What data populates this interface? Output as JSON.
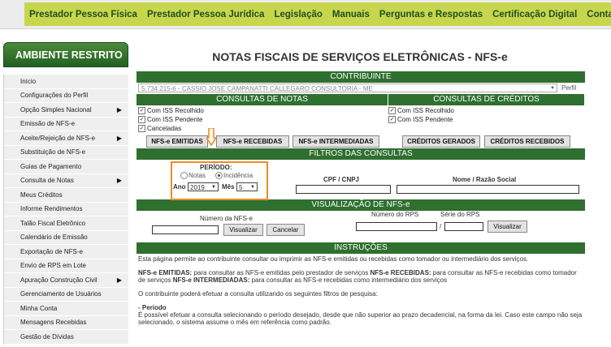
{
  "topnav": {
    "items": [
      "Prestador Pessoa Física",
      "Prestador Pessoa Jurídica",
      "Legislação",
      "Manuais",
      "Perguntas e Respostas",
      "Certificação Digital",
      "Contato"
    ]
  },
  "sidebar": {
    "title": "AMBIENTE RESTRITO",
    "items": [
      {
        "label": "Início",
        "arrow": ""
      },
      {
        "label": "Configurações do Perfil",
        "arrow": ""
      },
      {
        "label": "Opção Simples Nacional",
        "arrow": "▶"
      },
      {
        "label": "Emissão de NFS-e",
        "arrow": ""
      },
      {
        "label": "Aceite/Rejeição de NFS-e",
        "arrow": "▶"
      },
      {
        "label": "Substituição de NFS-e",
        "arrow": ""
      },
      {
        "label": "Guias de Pagamento",
        "arrow": ""
      },
      {
        "label": "Consulta de Notas",
        "arrow": "▶"
      },
      {
        "label": "Meus Créditos",
        "arrow": ""
      },
      {
        "label": "Informe Rendimentos",
        "arrow": ""
      },
      {
        "label": "Talão Fiscal Eletrônico",
        "arrow": ""
      },
      {
        "label": "Calendário de Emissão",
        "arrow": ""
      },
      {
        "label": "Exportação de NFS-e",
        "arrow": ""
      },
      {
        "label": "Envio de RPS em Lote",
        "arrow": ""
      },
      {
        "label": "Apuração Construção Civil",
        "arrow": "▶"
      },
      {
        "label": "Gerenciamento de Usuários",
        "arrow": ""
      },
      {
        "label": "Minha Conta",
        "arrow": ""
      },
      {
        "label": "Mensagens Recebidas",
        "arrow": ""
      },
      {
        "label": "Gestão de Dívidas",
        "arrow": ""
      }
    ]
  },
  "main": {
    "title": "NOTAS FISCAIS DE SERVIÇOS ELETRÔNICAS - NFS-e",
    "contribuinte_header": "CONTRIBUINTE",
    "contribuinte_value": "5.734.215-6 - CASSIO JOSE CAMPANATTI CALLEGARO CONSULTORIA - ME",
    "perfil_label": "Perfil",
    "consultas_notas_header": "CONSULTAS DE NOTAS",
    "consultas_creditos_header": "CONSULTAS DE CRÉDITOS",
    "notas_checks": [
      "Com ISS Recolhido",
      "Com ISS Pendente",
      "Canceladas"
    ],
    "creditos_checks": [
      "Com ISS Recolhido",
      "Com ISS Pendente"
    ],
    "buttons": {
      "emitidas": "NFS-e EMITIDAS",
      "recebidas": "NFS-e RECEBIDAS",
      "intermediadas": "NFS-e INTERMEDIADAS",
      "creditos_gerados": "CRÉDITOS GERADOS",
      "creditos_recebidos": "CRÉDITOS RECEBIDOS"
    },
    "filtros_header": "FILTROS DAS CONSULTAS",
    "periodo_label": "PERÍODO:",
    "radio_notas": "Notas",
    "radio_incidencia": "Incidência",
    "ano_label": "Ano",
    "ano_value": "2019",
    "mes_label": "Mês",
    "mes_value": "5",
    "cpf_label": "CPF / CNPJ",
    "nome_label": "Nome / Razão Social",
    "visualizacao_header": "VISUALIZAÇÃO DE NFS-e",
    "numero_nfse_label": "Número da NFS-e",
    "visualizar_label": "Visualizar",
    "cancelar_label": "Cancelar",
    "numero_rps_label": "Número do RPS",
    "serie_rps_label": "Série do RPS",
    "rps_separator": "/",
    "instrucoes_header": "INSTRUÇÕES",
    "instr_intro": "Esta página permite ao contribuinte consultar ou imprimir as NFS-e emitidas ou recebidas como tomador ou intermediário dos serviços.",
    "instr_emitidas_label": "NFS-e EMITIDAS:",
    "instr_emitidas_text": " para consultar as NFS-e emitidas pelo prestador de serviços ",
    "instr_recebidas_label": "NFS-e RECEBIDAS:",
    "instr_recebidas_text": " para consultar as NFS-e recebidas como tomador de serviços ",
    "instr_intermediadas_label": "NFS-e INTERMEDIADAS:",
    "instr_intermediadas_text": " para consultar as NFS-e recebidas como intermediário dos serviços",
    "instr_filtros": "O contribuinte poderá efetuar a consulta utilizando os seguintes filtros de pesquisa:",
    "instr_periodo_label": "- Período",
    "instr_periodo_text": "É possível efetuar a consulta selecionando o período desejado, desde que não superior ao prazo decadencial, na forma da lei. Caso este campo não seja selecionado, o sistema assume o mês em referência como padrão."
  },
  "colors": {
    "dark_green": "#2f6f2f",
    "nav_green": "#c8d64e",
    "highlight_orange": "#f08a24"
  }
}
